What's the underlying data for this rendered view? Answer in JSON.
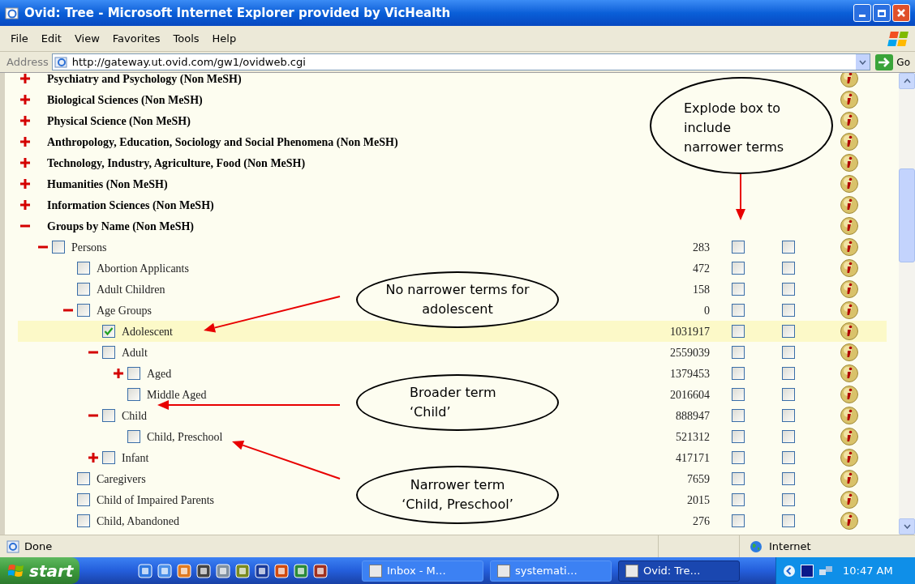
{
  "window": {
    "title": "Ovid: Tree - Microsoft Internet Explorer provided by VicHealth"
  },
  "menu": [
    "File",
    "Edit",
    "View",
    "Favorites",
    "Tools",
    "Help"
  ],
  "address_bar": {
    "label": "Address",
    "value": "http://gateway.ut.ovid.com/gw1/ovidweb.cgi",
    "go": "Go"
  },
  "tree": [
    {
      "kind": "category",
      "label": "Psychiatry and Psychology (Non MeSH)",
      "expanded": false,
      "selected": false
    },
    {
      "kind": "category",
      "label": "Biological Sciences (Non MeSH)",
      "expanded": false,
      "selected": false
    },
    {
      "kind": "category",
      "label": "Physical Science (Non MeSH)",
      "expanded": false,
      "selected": false
    },
    {
      "kind": "category",
      "label": "Anthropology, Education, Sociology and Social Phenomena (Non MeSH)",
      "expanded": false,
      "selected": false
    },
    {
      "kind": "category",
      "label": "Technology, Industry, Agriculture, Food (Non MeSH)",
      "expanded": false,
      "selected": false
    },
    {
      "kind": "category",
      "label": "Humanities (Non MeSH)",
      "expanded": false,
      "selected": false
    },
    {
      "kind": "category",
      "label": "Information Sciences (Non MeSH)",
      "expanded": false,
      "selected": false
    },
    {
      "kind": "category",
      "label": "Groups by Name (Non MeSH)",
      "expanded": true,
      "selected": false,
      "children": [
        {
          "kind": "term",
          "label": "Persons",
          "expanded": true,
          "checked": false,
          "selected": false,
          "count": "283",
          "explode_checked": false,
          "box_checked": false,
          "children": [
            {
              "kind": "term",
              "label": "Abortion Applicants",
              "checked": false,
              "selected": false,
              "count": "472",
              "explode_checked": false,
              "box_checked": false
            },
            {
              "kind": "term",
              "label": "Adult Children",
              "checked": false,
              "selected": false,
              "count": "158",
              "explode_checked": false,
              "box_checked": false
            },
            {
              "kind": "term",
              "label": "Age Groups",
              "expanded": true,
              "checked": false,
              "selected": false,
              "count": "0",
              "explode_checked": false,
              "box_checked": false,
              "children": [
                {
                  "kind": "term",
                  "label": "Adolescent",
                  "checked": true,
                  "selected": true,
                  "count": "1031917",
                  "explode_checked": false,
                  "box_checked": false
                },
                {
                  "kind": "term",
                  "label": "Adult",
                  "expanded": true,
                  "checked": false,
                  "selected": false,
                  "count": "2559039",
                  "explode_checked": false,
                  "box_checked": false,
                  "children": [
                    {
                      "kind": "term",
                      "label": "Aged",
                      "expanded": false,
                      "checked": false,
                      "selected": false,
                      "count": "1379453",
                      "explode_checked": false,
                      "box_checked": false
                    },
                    {
                      "kind": "term",
                      "label": "Middle Aged",
                      "checked": false,
                      "selected": false,
                      "count": "2016604",
                      "explode_checked": false,
                      "box_checked": false
                    }
                  ]
                },
                {
                  "kind": "term",
                  "label": "Child",
                  "expanded": true,
                  "checked": false,
                  "selected": false,
                  "count": "888947",
                  "explode_checked": false,
                  "box_checked": false,
                  "children": [
                    {
                      "kind": "term",
                      "label": "Child, Preschool",
                      "checked": false,
                      "selected": false,
                      "count": "521312",
                      "explode_checked": false,
                      "box_checked": false
                    }
                  ]
                },
                {
                  "kind": "term",
                  "label": "Infant",
                  "expanded": false,
                  "checked": false,
                  "selected": false,
                  "count": "417171",
                  "explode_checked": false,
                  "box_checked": false
                }
              ]
            },
            {
              "kind": "term",
              "label": "Caregivers",
              "checked": false,
              "selected": false,
              "count": "7659",
              "explode_checked": false,
              "box_checked": false
            },
            {
              "kind": "term",
              "label": "Child of Impaired Parents",
              "checked": false,
              "selected": false,
              "count": "2015",
              "explode_checked": false,
              "box_checked": false
            },
            {
              "kind": "term",
              "label": "Child, Abandoned",
              "checked": false,
              "selected": false,
              "count": "276",
              "explode_checked": false,
              "box_checked": false
            }
          ]
        }
      ]
    }
  ],
  "callouts": [
    {
      "lines": [
        "Explode box to",
        "include",
        "narrower terms"
      ]
    },
    {
      "lines": [
        "No narrower terms for",
        "adolescent"
      ]
    },
    {
      "lines": [
        "Broader term",
        "‘Child’"
      ]
    },
    {
      "lines": [
        "Narrower term",
        "‘Child, Preschool’"
      ]
    }
  ],
  "status_bar": {
    "text": "Done",
    "zone": "Internet"
  },
  "taskbar": {
    "start": "start",
    "tasks": [
      {
        "label": "Inbox - M…",
        "selected": false
      },
      {
        "label": "systemati…",
        "selected": false
      },
      {
        "label": "Ovid: Tre…",
        "selected": true
      }
    ],
    "clock": "10:47 AM"
  }
}
